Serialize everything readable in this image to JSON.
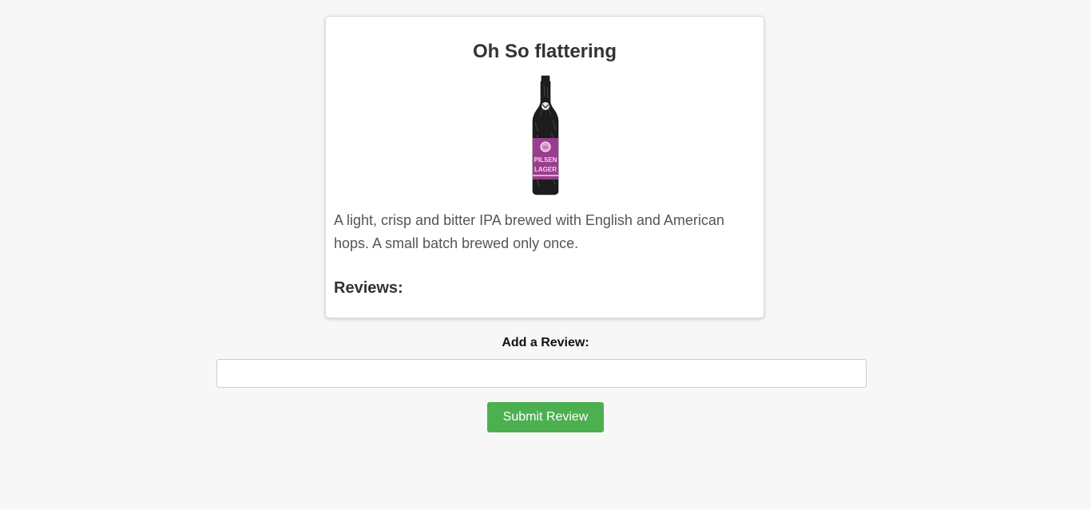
{
  "beer": {
    "name": "Oh So flattering",
    "description": "A light, crisp and bitter IPA brewed with English and American hops. A small batch brewed only once.",
    "image_alt": "Pilsen Lager bottle",
    "label_line1": "PILSEN",
    "label_line2": "LAGER"
  },
  "reviews": {
    "heading": "Reviews:"
  },
  "review_form": {
    "label": "Add a Review:",
    "input_value": "",
    "input_placeholder": "",
    "submit_label": "Submit Review"
  },
  "colors": {
    "background": "#f7f7f7",
    "card": "#ffffff",
    "accent_button": "#4caf50",
    "bottle_label": "#9b3d8f"
  }
}
